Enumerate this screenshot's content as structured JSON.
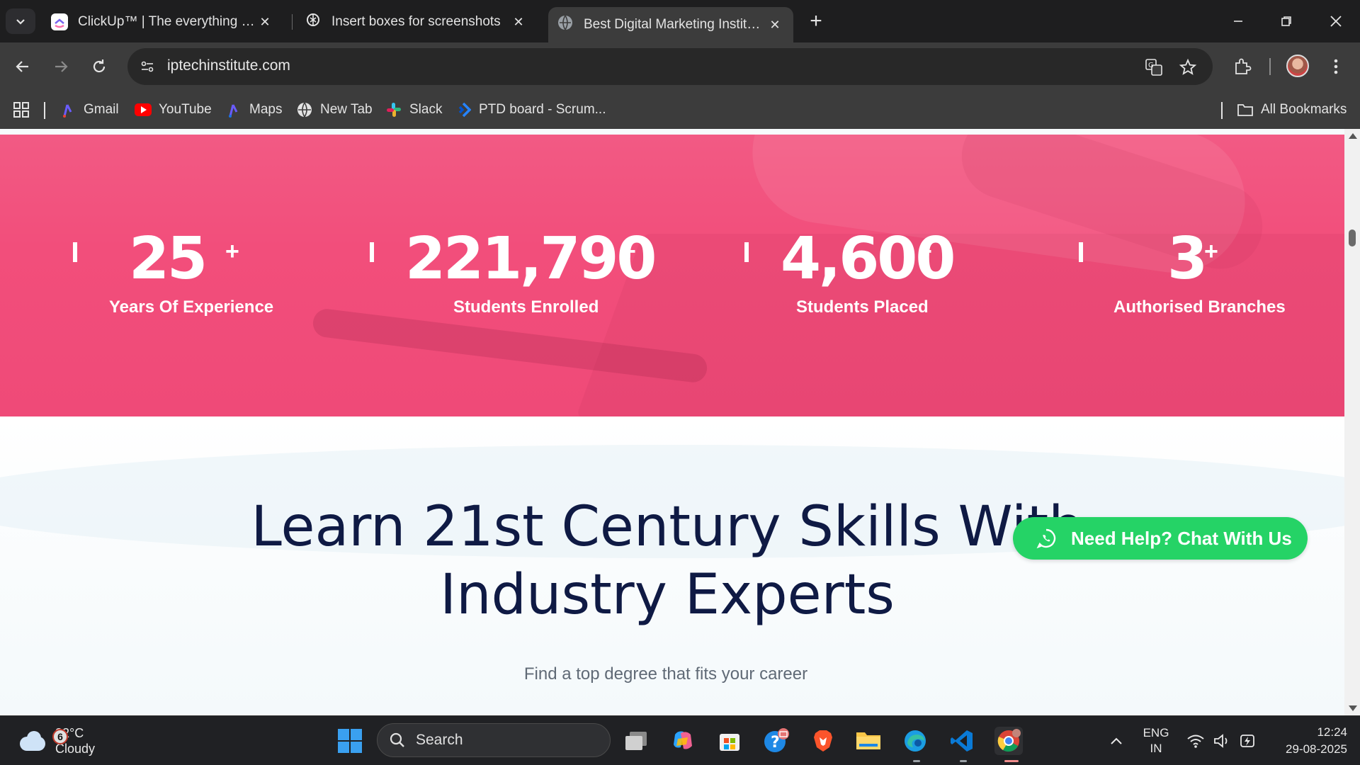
{
  "tabs": [
    {
      "title": "ClickUp™ | The everything app fo",
      "icon": "clickup-icon",
      "active": false
    },
    {
      "title": "Insert boxes for screenshots",
      "icon": "chatgpt-icon",
      "active": false
    },
    {
      "title": "Best Digital Marketing Institute",
      "icon": "globe-icon",
      "active": true
    }
  ],
  "address_bar": {
    "url": "iptechinstitute.com"
  },
  "bookmarks": {
    "items": [
      {
        "label": "Gmail",
        "icon": "gmail-icon"
      },
      {
        "label": "YouTube",
        "icon": "youtube-icon"
      },
      {
        "label": "Maps",
        "icon": "maps-icon"
      },
      {
        "label": "New Tab",
        "icon": "globe-icon"
      },
      {
        "label": "Slack",
        "icon": "slack-icon"
      },
      {
        "label": "PTD board - Scrum...",
        "icon": "jira-icon"
      }
    ],
    "all_bookmarks": "All Bookmarks"
  },
  "stats": [
    {
      "value": "25",
      "suffix": "+",
      "label": "Years Of Experience"
    },
    {
      "value": "221,790",
      "suffix": "+",
      "label": "Students Enrolled"
    },
    {
      "value": "4,600",
      "suffix": "+",
      "label": "Students Placed"
    },
    {
      "value": "3",
      "suffix": "+",
      "label": "Authorised Branches"
    }
  ],
  "section": {
    "heading_line1": "Learn 21st Century Skills With",
    "heading_line2": "Industry Experts",
    "subheading": "Find a top degree that fits your career"
  },
  "chat_button": {
    "label": "Need Help? Chat With Us"
  },
  "taskbar": {
    "weather": {
      "badge": "6",
      "temp": "32°C",
      "condition": "Cloudy"
    },
    "search_placeholder": "Search",
    "language": {
      "line1": "ENG",
      "line2": "IN"
    },
    "clock": {
      "time": "12:24",
      "date": "29-08-2025"
    }
  },
  "colors": {
    "accent_pink": "#f24e7b",
    "whatsapp_green": "#25d366",
    "heading_navy": "#0f1a44"
  }
}
